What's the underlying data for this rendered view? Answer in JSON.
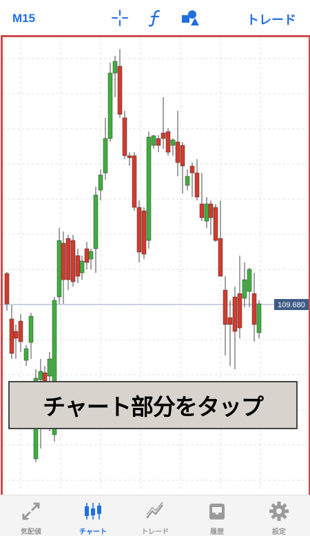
{
  "header": {
    "timeframe": "M15",
    "trade_label": "トレード"
  },
  "chart": {
    "price_label": "109.680",
    "colors": {
      "up": "#3fae3f",
      "down": "#d23a2e",
      "frame": "#cc4b4b",
      "accent": "#1f6fe0"
    }
  },
  "callout": {
    "text": "チャート部分をタップ"
  },
  "tabs": [
    {
      "label": "気配値",
      "icon": "quotes-icon"
    },
    {
      "label": "チャート",
      "icon": "candlestick-icon"
    },
    {
      "label": "トレード",
      "icon": "trade-icon"
    },
    {
      "label": "履歴",
      "icon": "history-icon"
    },
    {
      "label": "設定",
      "icon": "gear-icon"
    }
  ],
  "icons": [
    "crosshair-icon",
    "function-icon",
    "objects-icon"
  ]
}
